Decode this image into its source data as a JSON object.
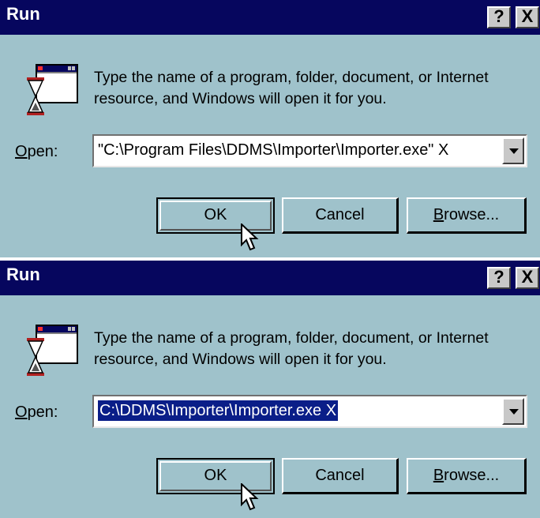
{
  "dialogs": [
    {
      "title": "Run",
      "help_button": "?",
      "close_button": "X",
      "description_line1": "Type the name of a program, folder, document, or Internet",
      "description_line2": "resource, and Windows will open it for you.",
      "open_label": "Open:",
      "open_accesskey": "O",
      "open_label_rest": "pen:",
      "open_value": "\"C:\\Program Files\\DDMS\\Importer\\Importer.exe\" X",
      "ok_label": "OK",
      "cancel_label": "Cancel",
      "browse_label": "Browse...",
      "browse_accesskey": "B",
      "browse_label_rest": "rowse..."
    },
    {
      "title": "Run",
      "help_button": "?",
      "close_button": "X",
      "description_line1": "Type the name of a program, folder, document, or Internet",
      "description_line2": "resource, and Windows will open it for you.",
      "open_label": "Open:",
      "open_accesskey": "O",
      "open_label_rest": "pen:",
      "open_value": "C:\\DDMS\\Importer\\Importer.exe X",
      "ok_label": "OK",
      "cancel_label": "Cancel",
      "browse_label": "Browse...",
      "browse_accesskey": "B",
      "browse_label_rest": "rowse..."
    }
  ],
  "colors": {
    "dialog_bg": "#9fc2cb",
    "titlebar_bg": "#06065e",
    "selection_bg": "#0a1e88"
  },
  "icons": [
    "run-program-icon",
    "help-icon",
    "close-icon",
    "dropdown-arrow-icon",
    "mouse-pointer-icon"
  ]
}
